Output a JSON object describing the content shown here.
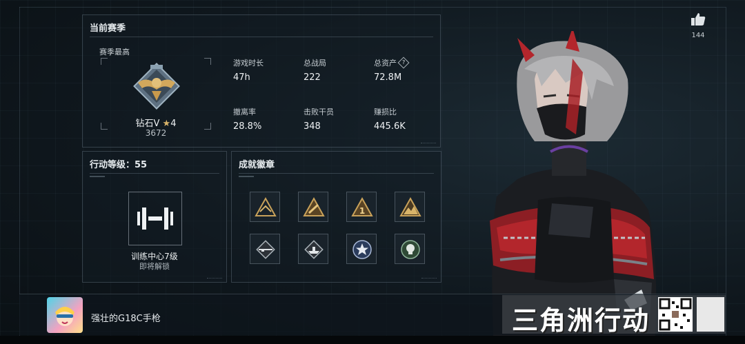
{
  "season": {
    "title": "当前赛季",
    "best_label": "赛季最高",
    "rank_name": "钻石V",
    "rank_stars": "4",
    "rank_score": "3672",
    "stats": [
      {
        "label": "游戏时长",
        "value": "47h"
      },
      {
        "label": "总战局",
        "value": "222"
      },
      {
        "label": "总资产",
        "value": "72.8M",
        "help": "?"
      },
      {
        "label": "撤离率",
        "value": "28.8%"
      },
      {
        "label": "击败干员",
        "value": "348"
      },
      {
        "label": "赚损比",
        "value": "445.6K"
      }
    ]
  },
  "level": {
    "title": "行动等级：55",
    "item_name": "训练中心7级",
    "item_status": "即将解锁"
  },
  "badges": {
    "title": "成就徽章",
    "icons": [
      "badge-chevron-icon",
      "badge-slash-icon",
      "badge-one-icon",
      "badge-mountain-icon",
      "badge-rifle-icon",
      "badge-ship-icon",
      "badge-star-icon",
      "badge-skull-icon"
    ]
  },
  "footer": {
    "weapon_name": "强壮的G18C手枪"
  },
  "likes": {
    "count": "144"
  },
  "logo": {
    "text": "三角洲行动"
  },
  "colors": {
    "accent_gold": "#d8b46a",
    "panel_border": "#96aab9",
    "character_red": "#b3262c"
  }
}
